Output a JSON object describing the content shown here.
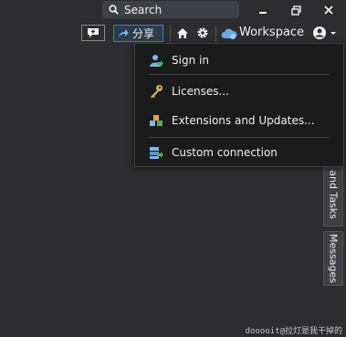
{
  "titlebar": {
    "search_placeholder": "Search",
    "minimize_glyph": "▁",
    "restore_glyph": "❐",
    "close_glyph": "✕"
  },
  "toolbar": {
    "share_label": "分享",
    "workspace_label": "Workspace"
  },
  "menu": {
    "items": [
      {
        "label": "Sign in",
        "icon": "user-signin-icon"
      },
      {
        "label": "Licenses...",
        "icon": "key-icon"
      },
      {
        "label": "Extensions and Updates...",
        "icon": "extensions-icon"
      },
      {
        "label": "Custom connection",
        "icon": "server-connection-icon"
      }
    ]
  },
  "side_tabs": {
    "tab1": "s and Tasks",
    "tab2": "Messages"
  },
  "watermark": "dooooit@拉灯是我干掉的",
  "colors": {
    "background": "#2d2d30",
    "menu_background": "#1b1b1c",
    "accent": "#3c7fb1"
  }
}
